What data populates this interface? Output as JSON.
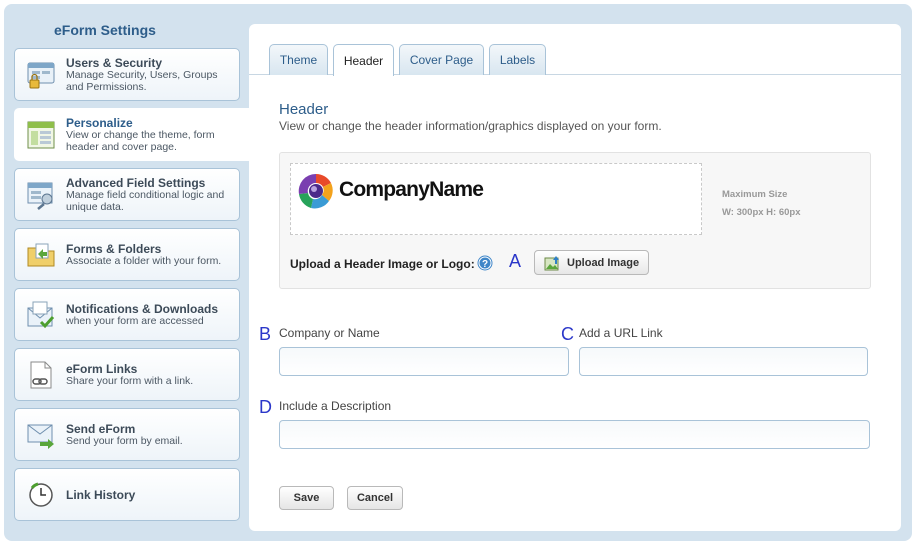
{
  "sidebar": {
    "title": "eForm Settings",
    "items": [
      {
        "title": "Users & Security",
        "sub1": "Manage Security, Users, Groups",
        "sub2": "and Permissions."
      },
      {
        "title": "Personalize",
        "sub1": "View or change the theme, form",
        "sub2": "header and cover page."
      },
      {
        "title": "Advanced Field Settings",
        "sub1": "Manage field conditional logic and",
        "sub2": "unique data."
      },
      {
        "title": "Forms & Folders",
        "sub1": "Associate a folder with your form.",
        "sub2": ""
      },
      {
        "title": "Notifications & Downloads",
        "sub1": "when your form are accessed",
        "sub2": ""
      },
      {
        "title": "eForm Links",
        "sub1": "Share your form with a link.",
        "sub2": ""
      },
      {
        "title": "Send eForm",
        "sub1": "Send your form by email.",
        "sub2": ""
      },
      {
        "title": "Link History",
        "sub1": "",
        "sub2": ""
      }
    ]
  },
  "tabs": [
    "Theme",
    "Header",
    "Cover Page",
    "Labels"
  ],
  "active_tab": "Header",
  "header": {
    "title": "Header",
    "description": "View or change the header information/graphics displayed on your form."
  },
  "logo": {
    "company_text": "CompanyName",
    "max_size_label": "Maximum Size",
    "max_size_value": "W: 300px H: 60px"
  },
  "upload": {
    "label": "Upload a Header Image or Logo:",
    "button": "Upload Image"
  },
  "markers": {
    "a": "A",
    "b": "B",
    "c": "C",
    "d": "D"
  },
  "form": {
    "company_label": "Company or Name",
    "company_value": "",
    "url_label": "Add a URL Link",
    "url_value": "",
    "description_label": "Include a Description",
    "description_value": ""
  },
  "buttons": {
    "save": "Save",
    "cancel": "Cancel"
  },
  "colors": {
    "accent": "#2d5d8a",
    "marker": "#2b37c9",
    "panel_bg": "#d3e2ee"
  }
}
